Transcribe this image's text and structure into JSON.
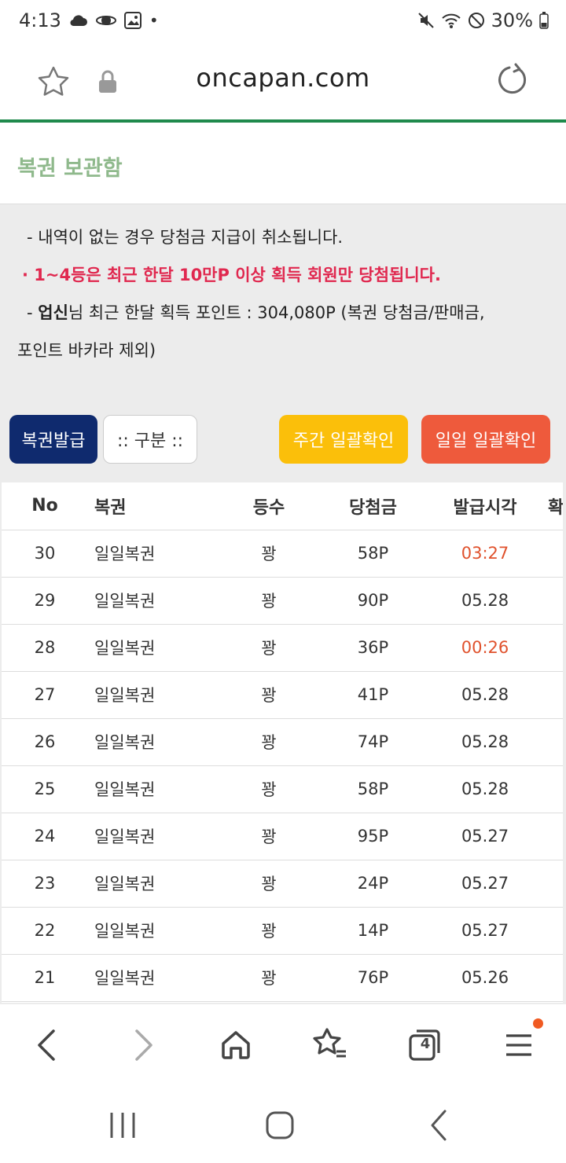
{
  "status": {
    "time": "4:13",
    "battery": "30%"
  },
  "browser": {
    "host": "oncapan.com",
    "tab_count": "4"
  },
  "page": {
    "title": "복권 보관함"
  },
  "notice": {
    "line1": "- 내역이 없는 경우 당첨금 지급이 취소됩니다.",
    "line2": "· 1~4등은 최근 한달 10만P 이상 획득 회원만 당첨됩니다.",
    "line3_prefix": "- ",
    "line3_user": "업신",
    "line3_rest": "님 최근 한달 획득 포인트 : 304,080P (복권 당첨금/판매금,",
    "line4": "포인트 바카라 제외)"
  },
  "buttons": {
    "issue": "복권발급",
    "sort": ":: 구분 ::",
    "weekly": "주간 일괄확인",
    "daily": "일일 일괄확인"
  },
  "table": {
    "headers": {
      "no": "No",
      "name": "복권",
      "rank": "등수",
      "prize": "당첨금",
      "time": "발급시각",
      "extra": "확"
    },
    "rows": [
      {
        "no": "30",
        "name": "일일복권",
        "rank": "꽝",
        "prize": "58P",
        "time": "03:27"
      },
      {
        "no": "29",
        "name": "일일복권",
        "rank": "꽝",
        "prize": "90P",
        "time": "05.28"
      },
      {
        "no": "28",
        "name": "일일복권",
        "rank": "꽝",
        "prize": "36P",
        "time": "00:26"
      },
      {
        "no": "27",
        "name": "일일복권",
        "rank": "꽝",
        "prize": "41P",
        "time": "05.28"
      },
      {
        "no": "26",
        "name": "일일복권",
        "rank": "꽝",
        "prize": "74P",
        "time": "05.28"
      },
      {
        "no": "25",
        "name": "일일복권",
        "rank": "꽝",
        "prize": "58P",
        "time": "05.28"
      },
      {
        "no": "24",
        "name": "일일복권",
        "rank": "꽝",
        "prize": "95P",
        "time": "05.27"
      },
      {
        "no": "23",
        "name": "일일복권",
        "rank": "꽝",
        "prize": "24P",
        "time": "05.27"
      },
      {
        "no": "22",
        "name": "일일복권",
        "rank": "꽝",
        "prize": "14P",
        "time": "05.27"
      },
      {
        "no": "21",
        "name": "일일복권",
        "rank": "꽝",
        "prize": "76P",
        "time": "05.26"
      }
    ]
  },
  "colors": {
    "accent_green": "#1f8a4c",
    "issue_btn": "#0f2a6e",
    "weekly_btn": "#fbbf0a",
    "daily_btn": "#ee5a3c",
    "highlight_time": "#e0522d",
    "alert_text": "#e0284f"
  }
}
